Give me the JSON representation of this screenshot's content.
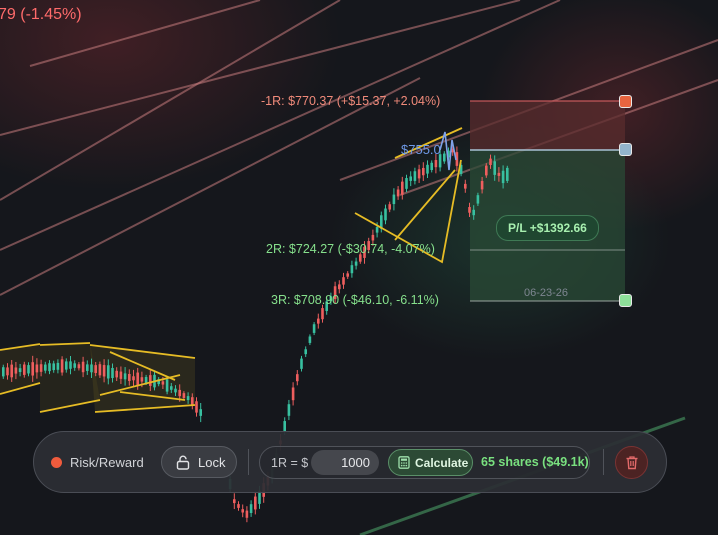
{
  "header": {
    "change_text": "79 (-1.45%)"
  },
  "chart": {
    "levels": {
      "risk_1r": "-1R: $770.37 (+$15.37, +2.04%)",
      "reward_2r": "2R: $724.27 (-$30.74, -4.07%)",
      "reward_3r": "3R: $708.90 (-$46.10, -6.11%)"
    },
    "current_price": "$755.0",
    "position": {
      "pl": "P/L +$1392.66",
      "date": "06-23-26"
    }
  },
  "toolbar": {
    "tool_name": "Risk/Reward",
    "lock_label": "Lock",
    "r_prefix": "1R = $",
    "r_value": "1000",
    "calculate_label": "Calculate",
    "shares_text": "65 shares ($49.1k)"
  },
  "colors": {
    "accent_red": "#ef5b3d",
    "accent_green": "#79e07f",
    "accent_blue": "#6f9ae8",
    "background": "#15171c"
  },
  "icons": {
    "indicator": "dot-icon",
    "lock": "unlock-icon",
    "calculate": "calculator-icon",
    "delete": "trash-icon"
  }
}
